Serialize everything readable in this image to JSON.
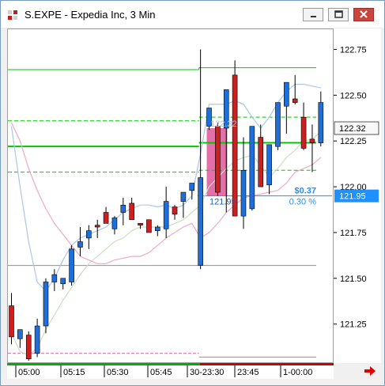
{
  "window": {
    "title": "S.EXPE - Expedia Inc, 3 Min",
    "buttons": {
      "minimize": "minimize-icon",
      "maximize": "maximize-icon",
      "close": "close-icon"
    }
  },
  "colors": {
    "up_candle": "#1e6fd9",
    "down_candle": "#cc1f1f",
    "band_fill": "#e0579a",
    "green_level": "#00c800",
    "upper_band": "#a8c8e8",
    "lower_band": "#f0a8c8",
    "mid_band": "#c8e0c0",
    "last_price_box": "#1e90ff",
    "prev_close_box": "#555555",
    "session_bar_green": "#00b000",
    "session_bar_red": "#cc0000"
  },
  "chart_data": {
    "type": "candlestick",
    "title": "S.EXPE - Expedia Inc, 3 Min",
    "y_ticks": [
      "122.75",
      "122.50",
      "122.25",
      "122.00",
      "121.75",
      "121.50",
      "121.25"
    ],
    "ylim": [
      121.03,
      122.85
    ],
    "x_ticks": [
      "05:00",
      "05:15",
      "05:30",
      "05:45",
      "30-23:30",
      "23:45",
      "1-00:00"
    ],
    "series": [
      {
        "name": "candles",
        "ohlc": [
          [
            121.35,
            121.42,
            121.14,
            121.18
          ],
          [
            121.17,
            121.22,
            121.12,
            121.22
          ],
          [
            121.19,
            121.21,
            121.05,
            121.06
          ],
          [
            121.09,
            121.28,
            121.07,
            121.24
          ],
          [
            121.24,
            121.5,
            121.2,
            121.48
          ],
          [
            121.48,
            121.55,
            121.43,
            121.52
          ],
          [
            121.47,
            121.5,
            121.44,
            121.5
          ],
          [
            121.48,
            121.68,
            121.46,
            121.66
          ],
          [
            121.67,
            121.78,
            121.62,
            121.7
          ],
          [
            121.72,
            121.79,
            121.66,
            121.76
          ],
          [
            121.79,
            121.82,
            121.72,
            121.78
          ],
          [
            121.86,
            121.89,
            121.8,
            121.8
          ],
          [
            121.77,
            121.84,
            121.74,
            121.83
          ],
          [
            121.86,
            121.94,
            121.79,
            121.9
          ],
          [
            121.91,
            121.94,
            121.86,
            121.82
          ],
          [
            121.8,
            121.8,
            121.77,
            121.79
          ],
          [
            121.82,
            121.82,
            121.75,
            121.75
          ],
          [
            121.76,
            121.79,
            121.73,
            121.78
          ],
          [
            121.77,
            122.0,
            121.72,
            121.92
          ],
          [
            121.89,
            121.9,
            121.82,
            121.85
          ],
          [
            121.92,
            121.96,
            121.83,
            121.97
          ],
          [
            121.98,
            122.0,
            121.93,
            122.02
          ],
          [
            121.57,
            122.75,
            121.55,
            122.05
          ],
          [
            122.33,
            122.42,
            122.31,
            122.43
          ],
          [
            122.33,
            122.35,
            121.95,
            121.97
          ],
          [
            122.32,
            122.53,
            121.86,
            122.53
          ],
          [
            122.61,
            122.69,
            121.89,
            121.84
          ],
          [
            121.84,
            122.27,
            121.77,
            122.09
          ],
          [
            121.88,
            122.27,
            121.87,
            122.33
          ],
          [
            122.27,
            122.34,
            122.05,
            122.0
          ],
          [
            122.01,
            122.23,
            121.96,
            122.23
          ],
          [
            122.22,
            122.45,
            122.2,
            122.46
          ],
          [
            122.44,
            122.57,
            122.29,
            122.57
          ],
          [
            122.48,
            122.61,
            122.45,
            122.46
          ],
          [
            122.38,
            122.46,
            122.2,
            122.21
          ],
          [
            122.26,
            122.34,
            122.08,
            122.24
          ],
          [
            122.24,
            122.52,
            122.22,
            122.46
          ]
        ]
      }
    ],
    "horizontal_levels_values": [
      122.32,
      122.23,
      122.1,
      121.57,
      121.09,
      122.65
    ],
    "annotations": {
      "box_top_label": "122.32",
      "box_bottom_label": "121.95",
      "change_amount": "$0.37",
      "change_percent": "0.30 %",
      "prev_close_label": "122.32",
      "last_price_label": "121.95"
    }
  }
}
